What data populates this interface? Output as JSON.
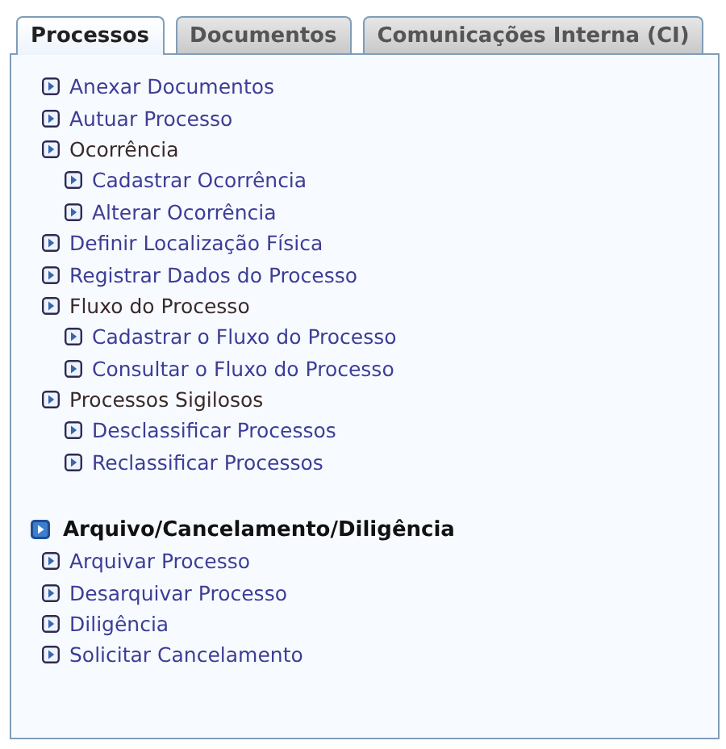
{
  "tabs": [
    {
      "label": "Processos",
      "selected": true
    },
    {
      "label": "Documentos",
      "selected": false
    },
    {
      "label": "Comunicações Interna (CI)",
      "selected": false
    }
  ],
  "menu": {
    "items": [
      {
        "kind": "link",
        "label": "Anexar Documentos"
      },
      {
        "kind": "link",
        "label": "Autuar Processo"
      },
      {
        "kind": "group",
        "label": "Ocorrência",
        "children": [
          {
            "kind": "link",
            "label": "Cadastrar Ocorrência"
          },
          {
            "kind": "link",
            "label": "Alterar Ocorrência"
          }
        ]
      },
      {
        "kind": "link",
        "label": "Definir Localização Física"
      },
      {
        "kind": "link",
        "label": "Registrar Dados do Processo"
      },
      {
        "kind": "group",
        "label": "Fluxo do Processo",
        "children": [
          {
            "kind": "link",
            "label": "Cadastrar o Fluxo do Processo"
          },
          {
            "kind": "link",
            "label": "Consultar o Fluxo do Processo"
          }
        ]
      },
      {
        "kind": "group",
        "label": "Processos Sigilosos",
        "children": [
          {
            "kind": "link",
            "label": "Desclassificar Processos"
          },
          {
            "kind": "link",
            "label": "Reclassificar Processos"
          }
        ]
      }
    ]
  },
  "section": {
    "title": "Arquivo/Cancelamento/Diligência",
    "items": [
      {
        "kind": "link",
        "label": "Arquivar Processo"
      },
      {
        "kind": "link",
        "label": "Desarquivar Processo"
      },
      {
        "kind": "link",
        "label": "Diligência"
      },
      {
        "kind": "link",
        "label": "Solicitar Cancelamento"
      }
    ]
  }
}
